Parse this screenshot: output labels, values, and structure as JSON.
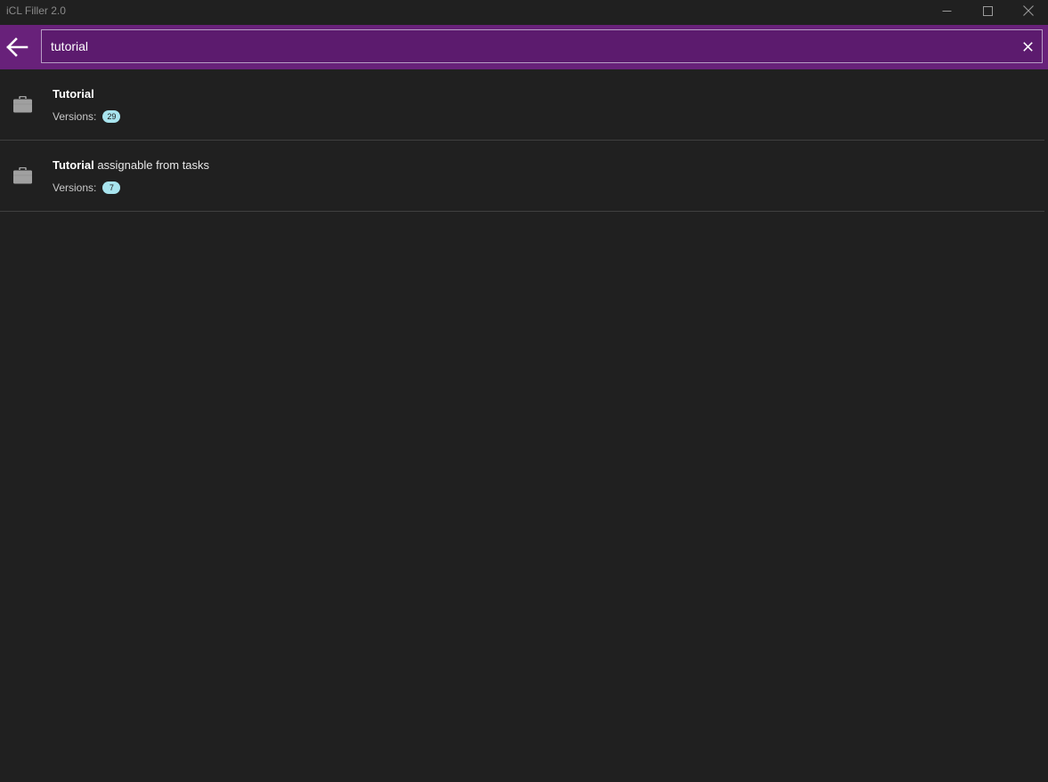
{
  "window": {
    "title": "iCL Filler 2.0"
  },
  "search": {
    "value": "tutorial",
    "placeholder": ""
  },
  "results": [
    {
      "name_match": "Tutorial",
      "name_rest": "",
      "versions_label": "Versions:",
      "versions_count": "29"
    },
    {
      "name_match": "Tutorial",
      "name_rest": " assignable from tasks",
      "versions_label": "Versions:",
      "versions_count": "7"
    }
  ],
  "icons": {
    "back": "arrow-left-icon",
    "clear": "close-icon",
    "item": "briefcase-icon",
    "minimize": "minimize-icon",
    "maximize": "maximize-icon",
    "close": "close-icon"
  },
  "colors": {
    "header": "#68217a",
    "background": "#202020",
    "badge": "#a8e4ee"
  }
}
